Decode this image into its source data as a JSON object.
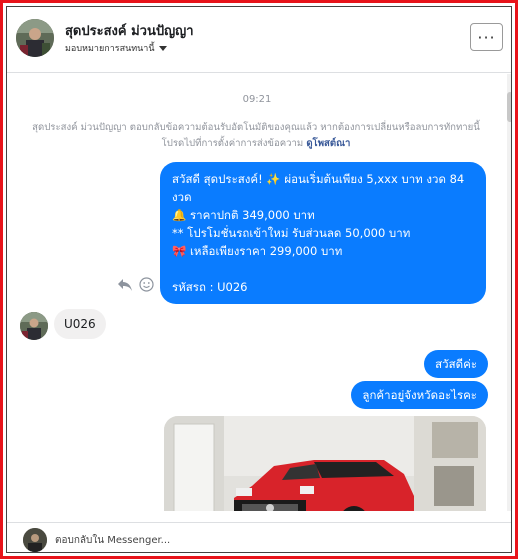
{
  "header": {
    "contact_name": "สุดประสงค์ ม่วนปัญญา",
    "assign_label": "มอบหมายการสนทนานี้",
    "more_label": "···"
  },
  "conversation": {
    "timestamp": "09:21",
    "notice_text": "สุดประสงค์ ม่วนปัญญา ตอบกลับข้อความต้อนรับอัตโนมัติของคุณแล้ว หากต้องการเปลี่ยนหรือลบการทักทายนี้ โปรดไปที่การตั้งค่าการส่งข้อความ",
    "notice_link": "ดูโพสต์ณา",
    "outgoing_promo_lines": [
      "สวัสดี สุดประสงค์! ✨  ผ่อนเริ่มต้นเพียง 5,xxx บาท งวด 84",
      "งวด",
      "🔔 ราคาปกติ 349,000 บาท",
      "** โปรโมชั่นรถเข้าใหม่ รับส่วนลด 50,000 บาท",
      "🎀  เหลือเพียงราคา 299,000 บาท",
      "",
      "รหัสรถ : U026"
    ],
    "incoming_message": "U026",
    "outgoing_greeting": "สวัสดีค่ะ",
    "outgoing_question": "ลูกค้าอยู่จังหวัดอะไรคะ"
  },
  "reply": {
    "placeholder": "ตอบกลับใน Messenger..."
  },
  "colors": {
    "frame_border": "#e8141b",
    "outgoing_bubble": "#0a7cff",
    "incoming_bubble": "#f1f0f0",
    "link": "#385898"
  },
  "icons": {
    "reply": "reply-arrow-icon",
    "react": "smiley-icon",
    "more": "more-dots-icon",
    "assign": "caret-down-icon"
  }
}
